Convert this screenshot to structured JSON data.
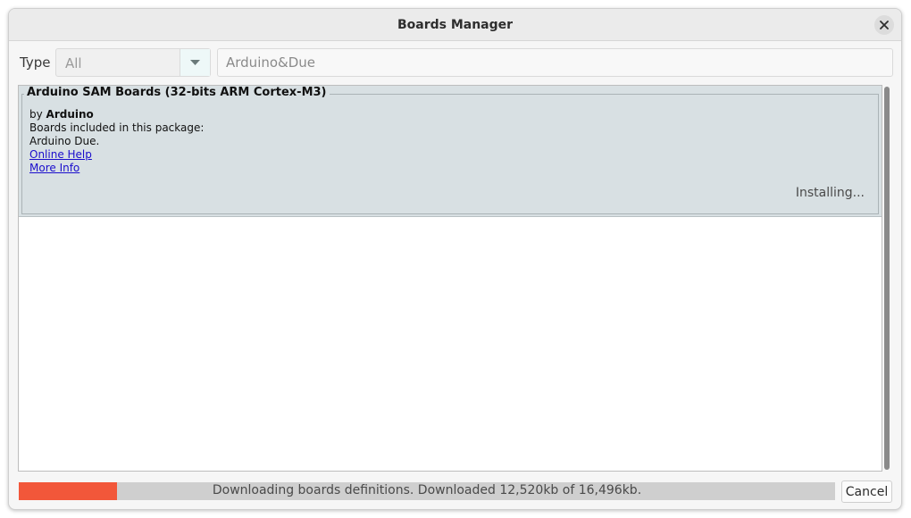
{
  "window": {
    "title": "Boards Manager"
  },
  "filter": {
    "type_label": "Type",
    "type_value": "All",
    "search_value": "Arduino&Due"
  },
  "package": {
    "title": "Arduino SAM Boards (32-bits ARM Cortex-M3)",
    "by_prefix": "by ",
    "maker": "Arduino",
    "boards_included": "Boards included in this package:",
    "boards": "Arduino Due.",
    "online_help": "Online Help",
    "more_info": "More Info",
    "status": "Installing..."
  },
  "progress": {
    "text": "Downloading boards definitions. Downloaded 12,520kb of 16,496kb.",
    "fraction": 0.12
  },
  "buttons": {
    "cancel": "Cancel"
  },
  "colors": {
    "progress_fill": "#f2573a",
    "card_background": "#d8e0e3",
    "link": "#1a0dcc"
  },
  "icons": {
    "close": "close-icon",
    "dropdown": "chevron-down-icon"
  }
}
